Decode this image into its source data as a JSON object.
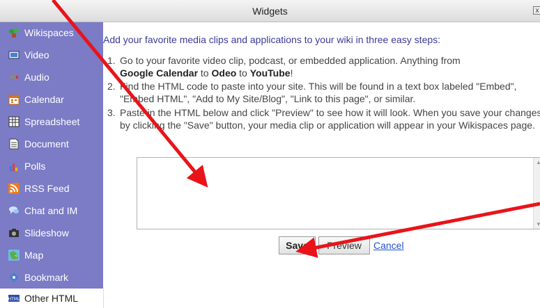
{
  "window": {
    "title": "Widgets",
    "close_label": "x"
  },
  "sidebar": {
    "items": [
      {
        "label": "Wikispaces",
        "icon": "plant-icon"
      },
      {
        "label": "Video",
        "icon": "video-icon"
      },
      {
        "label": "Audio",
        "icon": "speaker-icon"
      },
      {
        "label": "Calendar",
        "icon": "calendar-icon"
      },
      {
        "label": "Spreadsheet",
        "icon": "spreadsheet-icon"
      },
      {
        "label": "Document",
        "icon": "document-icon"
      },
      {
        "label": "Polls",
        "icon": "bar-chart-icon"
      },
      {
        "label": "RSS Feed",
        "icon": "rss-icon"
      },
      {
        "label": "Chat and IM",
        "icon": "chat-icon"
      },
      {
        "label": "Slideshow",
        "icon": "camera-icon"
      },
      {
        "label": "Map",
        "icon": "map-icon"
      },
      {
        "label": "Bookmark",
        "icon": "bookmark-icon"
      }
    ],
    "selected": {
      "label": "Other HTML",
      "icon": "html-icon"
    }
  },
  "main": {
    "intro": "Add your favorite media clips and applications to your wiki in three easy steps:",
    "steps": [
      {
        "num": "1.",
        "text_a": "Go to your favorite video clip, podcast, or embedded application. Anything from",
        "bold1": "Google Calendar",
        "mid1": " to ",
        "bold2": "Odeo",
        "mid2": " to ",
        "bold3": "YouTube",
        "end": "!"
      },
      {
        "num": "2.",
        "text": "Find the HTML code to paste into your site. This will be found in a text box labeled \"Embed\", \"Embed HTML\", \"Add to My Site/Blog\", \"Link to this page\", or similar."
      },
      {
        "num": "3.",
        "text": "Paste in the HTML below and click \"Preview\" to see how it will look. When you save your changes by clicking the \"Save\" button, your media clip or application will appear in your Wikispaces page."
      }
    ],
    "textarea_value": "",
    "buttons": {
      "save": "Save",
      "preview": "Preview",
      "cancel": "Cancel"
    }
  },
  "colors": {
    "sidebar_bg": "#7b7bc6",
    "intro_text": "#3a3a9a",
    "annotation_arrow": "#e8141a",
    "link": "#2255cc"
  }
}
